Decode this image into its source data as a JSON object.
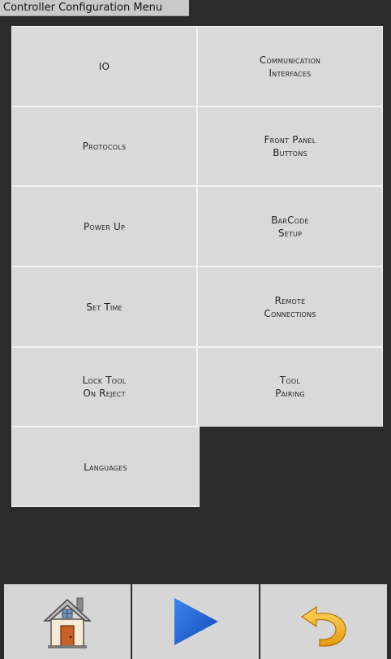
{
  "window": {
    "title": "Controller Configuration Menu"
  },
  "menu": {
    "io": "IO",
    "communication_interfaces": "Communication\nInterfaces",
    "protocols": "Protocols",
    "front_panel_buttons": "Front Panel\nButtons",
    "power_up": "Power Up",
    "barcode_setup": "BarCode\nSetup",
    "set_time": "Set Time",
    "remote_connections": "Remote\nConnections",
    "lock_tool_on_reject": "Lock Tool\nOn Reject",
    "tool_pairing": "Tool\nPairing",
    "languages": "Languages"
  },
  "footer": {
    "home_icon": "house-icon",
    "play_icon": "play-triangle-icon",
    "undo_icon": "undo-arrow-icon"
  },
  "colors": {
    "background": "#2b2b2b",
    "button": "#d9d9d9",
    "play_blue": "#1f5fd6",
    "undo_yellow": "#f3b22a"
  }
}
